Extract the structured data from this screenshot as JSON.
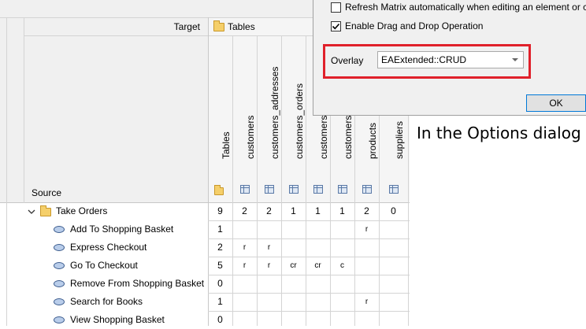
{
  "matrix": {
    "target_label": "Target",
    "target_package": "Tables",
    "source_label": "Source",
    "columns": [
      {
        "label": "Tables",
        "icon": "package-icon"
      },
      {
        "label": "customers",
        "icon": "table-icon"
      },
      {
        "label": "customers_addresses",
        "icon": "table-icon"
      },
      {
        "label": "customers_orders",
        "icon": "table-icon"
      },
      {
        "label": "customers_o",
        "icon": "table-icon"
      },
      {
        "label": "customers_o",
        "icon": "table-icon"
      },
      {
        "label": "products",
        "icon": "table-icon"
      },
      {
        "label": "suppliers",
        "icon": "table-icon"
      }
    ],
    "group_row": {
      "label": "Take Orders",
      "cells": [
        "9",
        "2",
        "2",
        "1",
        "1",
        "1",
        "2",
        "0"
      ]
    },
    "rows": [
      {
        "label": "Add To Shopping Basket",
        "cells": [
          "1",
          "",
          "",
          "",
          "",
          "",
          "r",
          ""
        ]
      },
      {
        "label": "Express Checkout",
        "cells": [
          "2",
          "r",
          "r",
          "",
          "",
          "",
          "",
          ""
        ]
      },
      {
        "label": "Go To Checkout",
        "cells": [
          "5",
          "r",
          "r",
          "cr",
          "cr",
          "c",
          "",
          ""
        ]
      },
      {
        "label": "Remove From Shopping Basket",
        "cells": [
          "0",
          "",
          "",
          "",
          "",
          "",
          "",
          ""
        ]
      },
      {
        "label": "Search for Books",
        "cells": [
          "1",
          "",
          "",
          "",
          "",
          "",
          "r",
          ""
        ]
      },
      {
        "label": "View Shopping Basket",
        "cells": [
          "0",
          "",
          "",
          "",
          "",
          "",
          "",
          ""
        ]
      }
    ]
  },
  "dialog": {
    "refresh_label": "Refresh Matrix automatically when editing an element or c",
    "refresh_checked": false,
    "dragdrop_label": "Enable Drag and Drop Operation",
    "dragdrop_checked": true,
    "overlay_label": "Overlay",
    "overlay_value": "EAExtended::CRUD",
    "ok_label": "OK"
  },
  "caption": "In the Options dialog",
  "colors": {
    "highlight_box": "#e0202a",
    "ok_border": "#0078d7"
  }
}
